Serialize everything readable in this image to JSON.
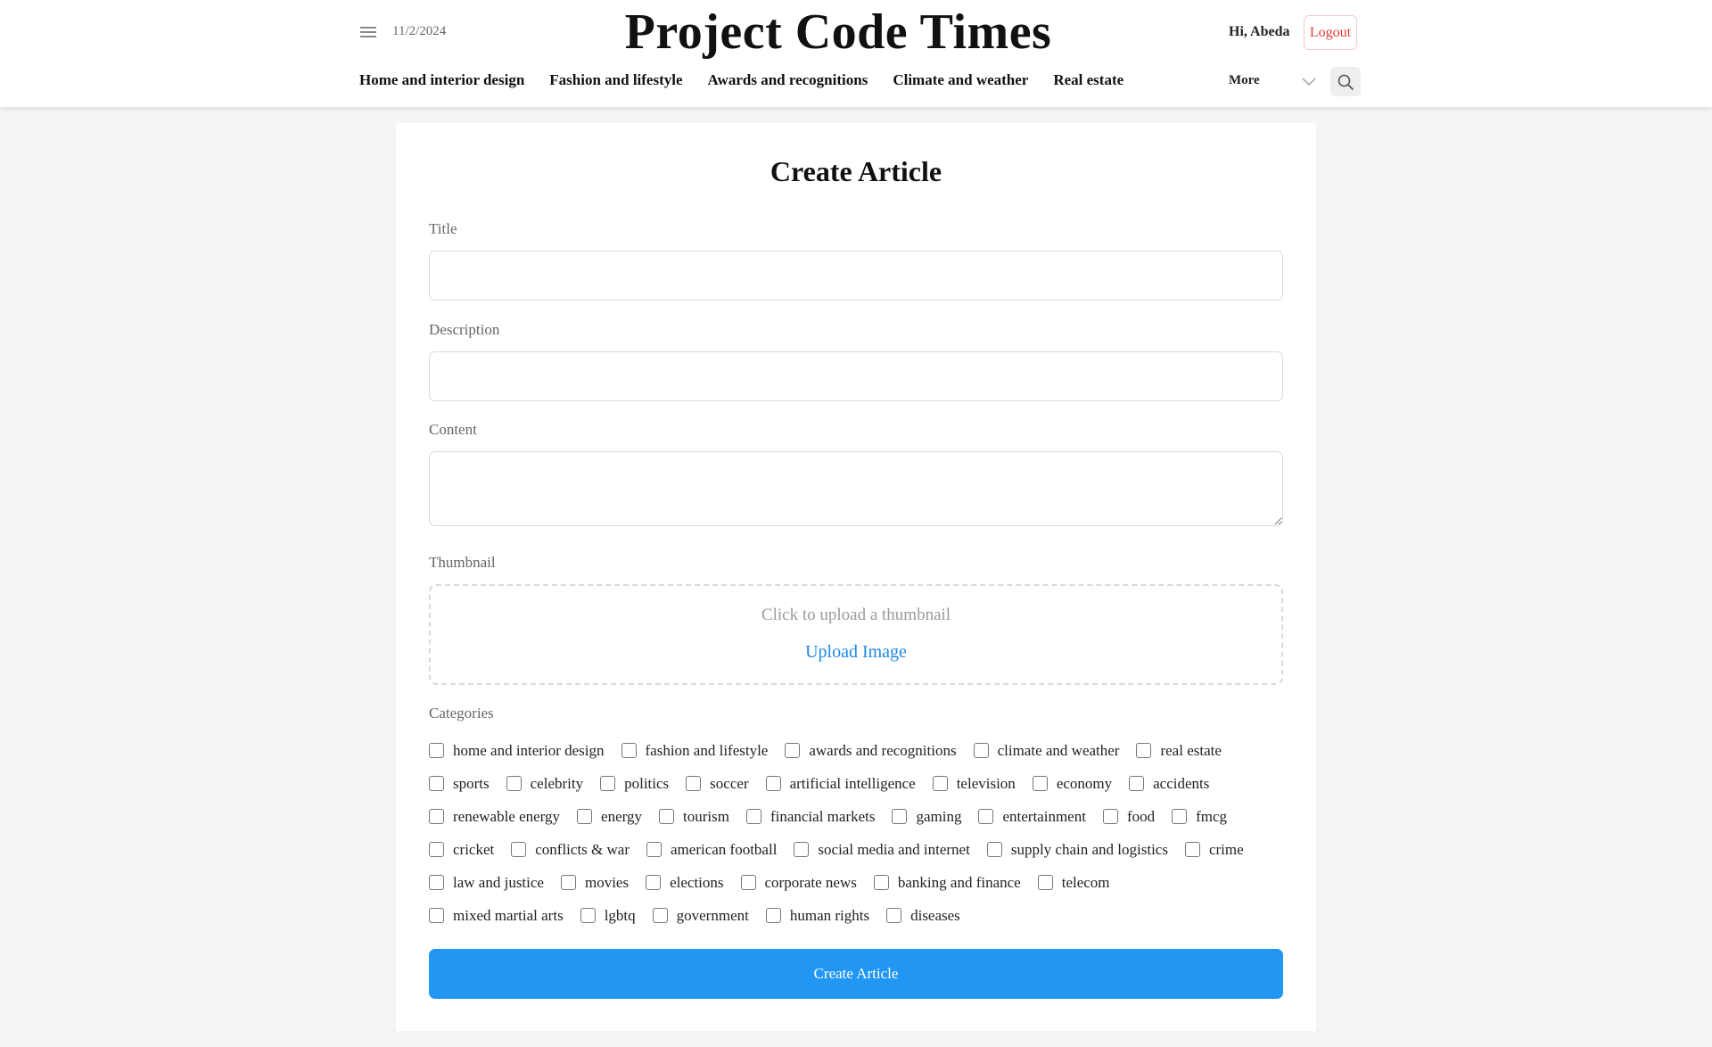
{
  "header": {
    "date": "11/2/2024",
    "site_title": "Project Code Times",
    "greeting": "Hi, Abeda",
    "logout_label": "Logout",
    "nav": [
      "Home and interior design",
      "Fashion and lifestyle",
      "Awards and recognitions",
      "Climate and weather",
      "Real estate"
    ],
    "more_label": "More",
    "icons": {
      "menu": "hamburger-icon",
      "chevron": "chevron-down-icon",
      "search": "search-icon"
    }
  },
  "form": {
    "heading": "Create Article",
    "title_label": "Title",
    "title_value": "",
    "description_label": "Description",
    "description_value": "",
    "content_label": "Content",
    "content_value": "",
    "thumbnail_label": "Thumbnail",
    "upload_hint": "Click to upload a thumbnail",
    "upload_link": "Upload Image",
    "categories_label": "Categories",
    "category_rows": [
      [
        "home and interior design",
        "fashion and lifestyle",
        "awards and recognitions",
        "climate and weather",
        "real estate"
      ],
      [
        "sports",
        "celebrity",
        "politics",
        "soccer",
        "artificial intelligence",
        "television",
        "economy",
        "accidents"
      ],
      [
        "renewable energy",
        "energy",
        "tourism",
        "financial markets",
        "gaming",
        "entertainment",
        "food",
        "fmcg"
      ],
      [
        "cricket",
        "conflicts & war",
        "american football",
        "social media and internet",
        "supply chain and logistics",
        "crime"
      ],
      [
        "law and justice",
        "movies",
        "elections",
        "corporate news",
        "banking and finance",
        "telecom"
      ],
      [
        "mixed martial arts",
        "lgbtq",
        "government",
        "human rights",
        "diseases"
      ]
    ],
    "submit_label": "Create Article"
  },
  "colors": {
    "accent": "#2196f3",
    "logout": "#e53935",
    "upload_link": "#1e88e5",
    "page_bg": "#f5f5f5"
  }
}
